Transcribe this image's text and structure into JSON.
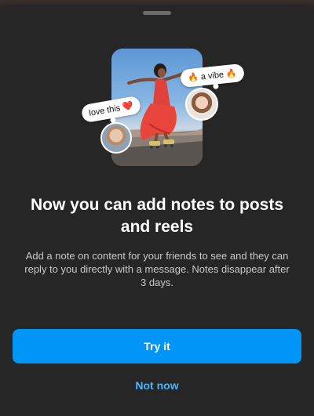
{
  "sheet": {
    "title": "Now you can add notes to posts and reels",
    "description": "Add a note on content for your friends to see and they can reply to you directly with a message. Notes disappear after 3 days.",
    "primary_button": "Try it",
    "secondary_button": "Not now"
  },
  "illustration": {
    "note_left": "love this ❤️",
    "note_right": "🔥 a vibe 🔥"
  },
  "colors": {
    "background": "#262626",
    "primary": "#0095f6",
    "link": "#4cb5f9"
  }
}
